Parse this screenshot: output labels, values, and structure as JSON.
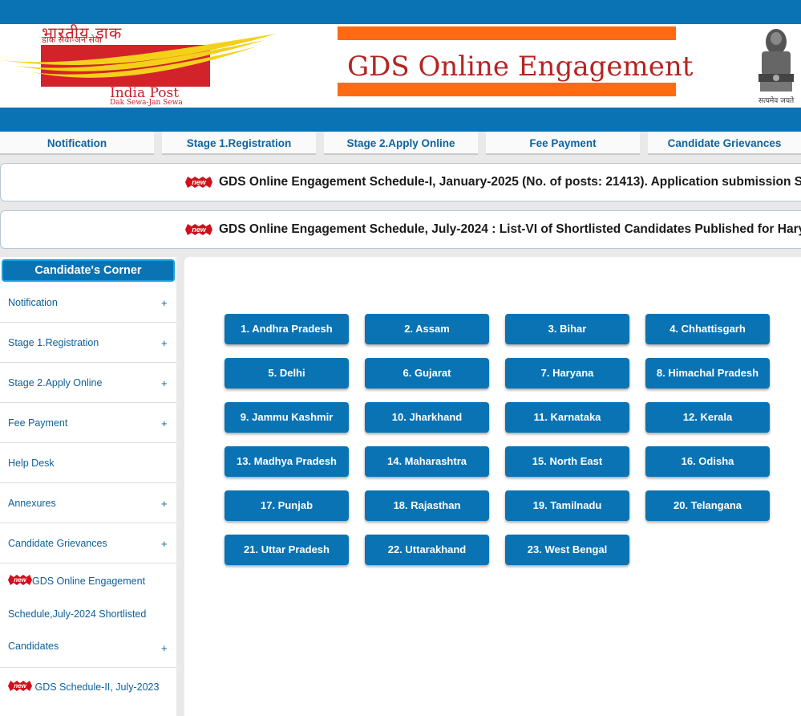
{
  "header": {
    "logo_hindi": "भारतीय डाक",
    "logo_hindi_tagline": "डाक सेवा-जन सेवा",
    "logo_name": "India Post",
    "logo_tagline": "Dak Sewa-Jan Sewa",
    "title": "GDS Online Engagement",
    "emblem_caption": "सत्यमेव जयते"
  },
  "nav": {
    "items": [
      "Notification",
      "Stage 1.Registration",
      "Stage 2.Apply Online",
      "Fee Payment",
      "Candidate Grievances"
    ]
  },
  "marquees": {
    "new_label": "new",
    "line1": "GDS Online Engagement Schedule-I, January-2025 (No. of posts: 21413). Application submission S",
    "line2": "GDS Online Engagement Schedule, July-2024 : List-VI of Shortlisted Candidates Published for Harya"
  },
  "sidebar": {
    "title": "Candidate's Corner",
    "plus": "+",
    "items": [
      "Notification",
      "Stage 1.Registration",
      "Stage 2.Apply Online",
      "Fee Payment",
      "Help Desk",
      "Annexures",
      "Candidate Grievances"
    ],
    "new_label": "new",
    "multi_line1": "GDS Online Engagement",
    "multi_line2": "Schedule,July-2024 Shortlisted",
    "multi_line3": "Candidates",
    "last_item": "GDS Schedule-II, July-2023"
  },
  "states": [
    "1. Andhra Pradesh",
    "2. Assam",
    "3. Bihar",
    "4. Chhattisgarh",
    "5. Delhi",
    "6. Gujarat",
    "7. Haryana",
    "8. Himachal Pradesh",
    "9. Jammu Kashmir",
    "10. Jharkhand",
    "11. Karnataka",
    "12. Kerala",
    "13. Madhya Pradesh",
    "14. Maharashtra",
    "15. North East",
    "16. Odisha",
    "17. Punjab",
    "18. Rajasthan",
    "19. Tamilnadu",
    "20. Telangana",
    "21. Uttar Pradesh",
    "22. Uttarakhand",
    "23. West Bengal"
  ],
  "colors": {
    "brand_blue": "#0a73b4",
    "title_red": "#b32521",
    "stripe_orange": "#ff6a13",
    "logo_red": "#d2232a",
    "logo_yellow": "#f4d01a"
  }
}
